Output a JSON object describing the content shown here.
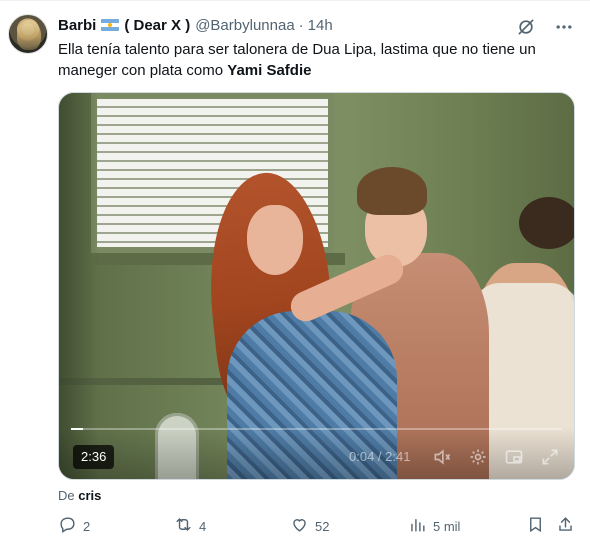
{
  "author": {
    "display_name": "Barbi",
    "flag_icon": "argentina-flag-icon",
    "display_name_suffix": "( Dear X )",
    "handle": "@Barbylunnaa",
    "separator": "·",
    "time": "14h"
  },
  "tweet": {
    "text_before": "Ella tenía talento para ser talonera de Dua Lipa, lastima que no tiene un maneger con plata como ",
    "text_bold": "Yami Safdie"
  },
  "video": {
    "duration_badge": "2:36",
    "time_readout": "0:04 / 2:41",
    "progress_fraction": 0.025
  },
  "from": {
    "prefix": "De",
    "name": "cris"
  },
  "actions": {
    "replies": "2",
    "reposts": "4",
    "likes": "52",
    "views": "5 mil"
  },
  "colors": {
    "text_primary": "#0f1419",
    "text_secondary": "#536471",
    "border": "#cfd9de"
  }
}
